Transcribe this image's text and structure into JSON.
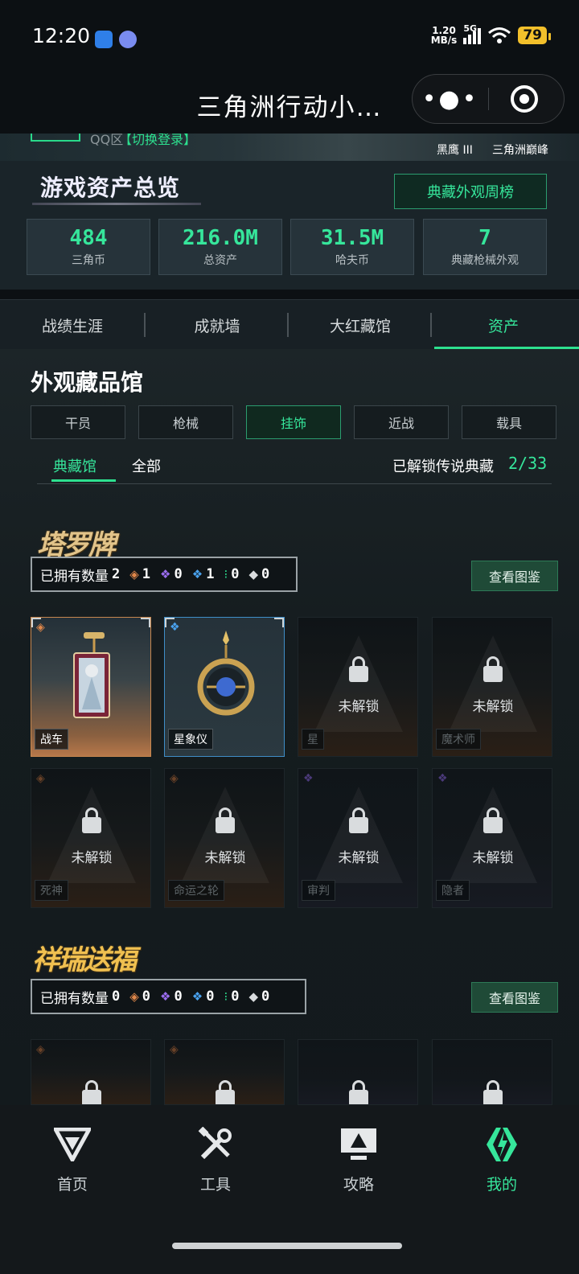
{
  "status_bar": {
    "time": "12:20",
    "net_speed_top": "1.20",
    "net_speed_bottom": "MB/s",
    "network": "5G",
    "battery": "79"
  },
  "title_bar": {
    "title": "三角洲行动小…",
    "more_icon": "more-dots-icon",
    "close_icon": "target-circle-icon"
  },
  "banner": {
    "account_prefix": "QQ区",
    "switch_login": "【切换登录】",
    "rank_1": "黑鹰 III",
    "rank_2": "三角洲巅峰"
  },
  "overview": {
    "title": "游戏资产总览",
    "weekly_button": "典藏外观周榜",
    "stats": [
      {
        "value": "484",
        "label": "三角币"
      },
      {
        "value": "216.0M",
        "label": "总资产"
      },
      {
        "value": "31.5M",
        "label": "哈夫币"
      },
      {
        "value": "7",
        "label": "典藏枪械外观"
      }
    ]
  },
  "tabs": [
    {
      "label": "战绩生涯"
    },
    {
      "label": "成就墙"
    },
    {
      "label": "大红藏馆"
    },
    {
      "label": "资产"
    }
  ],
  "collection": {
    "title": "外观藏品馆",
    "categories": [
      {
        "label": "干员"
      },
      {
        "label": "枪械"
      },
      {
        "label": "挂饰"
      },
      {
        "label": "近战"
      },
      {
        "label": "载具"
      }
    ],
    "sub_tabs": [
      {
        "label": "典藏馆"
      },
      {
        "label": "全部"
      }
    ],
    "unlock_label": "已解锁传说典藏",
    "unlock_value": "2/33",
    "series": [
      {
        "logo": "塔罗牌",
        "owned_label": "已拥有数量",
        "owned_total": "2",
        "rarities": [
          {
            "icon": "orange-diamond-icon",
            "count": "1"
          },
          {
            "icon": "purple-diamond-icon",
            "count": "0"
          },
          {
            "icon": "blue-diamond-icon",
            "count": "1"
          },
          {
            "icon": "green-diamond-icon",
            "count": "0"
          },
          {
            "icon": "white-diamond-icon",
            "count": "0"
          }
        ],
        "view_button": "查看图鉴",
        "items": [
          {
            "name": "战车",
            "locked": false,
            "rarity": "orange"
          },
          {
            "name": "星象仪",
            "locked": false,
            "rarity": "blue"
          },
          {
            "name": "星",
            "locked": true,
            "rarity": "orange"
          },
          {
            "name": "魔术师",
            "locked": true,
            "rarity": "orange"
          },
          {
            "name": "死神",
            "locked": true,
            "rarity": "orange"
          },
          {
            "name": "命运之轮",
            "locked": true,
            "rarity": "orange"
          },
          {
            "name": "审判",
            "locked": true,
            "rarity": "purple"
          },
          {
            "name": "隐者",
            "locked": true,
            "rarity": "purple"
          }
        ],
        "locked_text": "未解锁"
      },
      {
        "logo": "祥瑞送福",
        "owned_label": "已拥有数量",
        "owned_total": "0",
        "rarities": [
          {
            "icon": "orange-diamond-icon",
            "count": "0"
          },
          {
            "icon": "purple-diamond-icon",
            "count": "0"
          },
          {
            "icon": "blue-diamond-icon",
            "count": "0"
          },
          {
            "icon": "green-diamond-icon",
            "count": "0"
          },
          {
            "icon": "white-diamond-icon",
            "count": "0"
          }
        ],
        "view_button": "查看图鉴"
      }
    ]
  },
  "bottom_nav": [
    {
      "label": "首页",
      "icon": "logo-v-icon"
    },
    {
      "label": "工具",
      "icon": "tools-icon"
    },
    {
      "label": "攻略",
      "icon": "monitor-icon"
    },
    {
      "label": "我的",
      "icon": "profile-emblem-icon"
    }
  ],
  "colors": {
    "accent": "#36e69b",
    "rarity_orange": "#e0874a",
    "rarity_purple": "#9b6df0",
    "rarity_blue": "#4aa3f0",
    "rarity_green": "#2de08f"
  }
}
